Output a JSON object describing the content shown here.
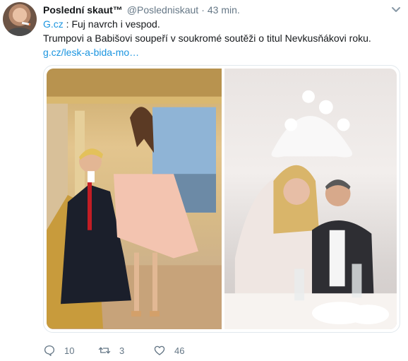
{
  "tweet": {
    "author_name": "Poslední skaut™",
    "author_handle": "@Posledniskaut",
    "separator": "·",
    "timestamp": "43 min.",
    "line1_link": "G.cz",
    "line1_text": " : Fuj navrch i vespod.",
    "line2": "Trumpovi a Babišovi soupeří v soukromé soutěži o titul Nevkusňákovi roku.",
    "line3_link": "g.cz/lesk-a-bida-mo…"
  },
  "actions": {
    "reply_count": "10",
    "retweet_count": "3",
    "like_count": "46"
  },
  "icons": {
    "avatar": "avatar",
    "caret": "chevron-down-icon",
    "reply": "reply-icon",
    "retweet": "retweet-icon",
    "like": "heart-icon"
  },
  "colors": {
    "link": "#1b95e0",
    "muted": "#657786",
    "text": "#14171a",
    "border": "#e1e8ed"
  }
}
